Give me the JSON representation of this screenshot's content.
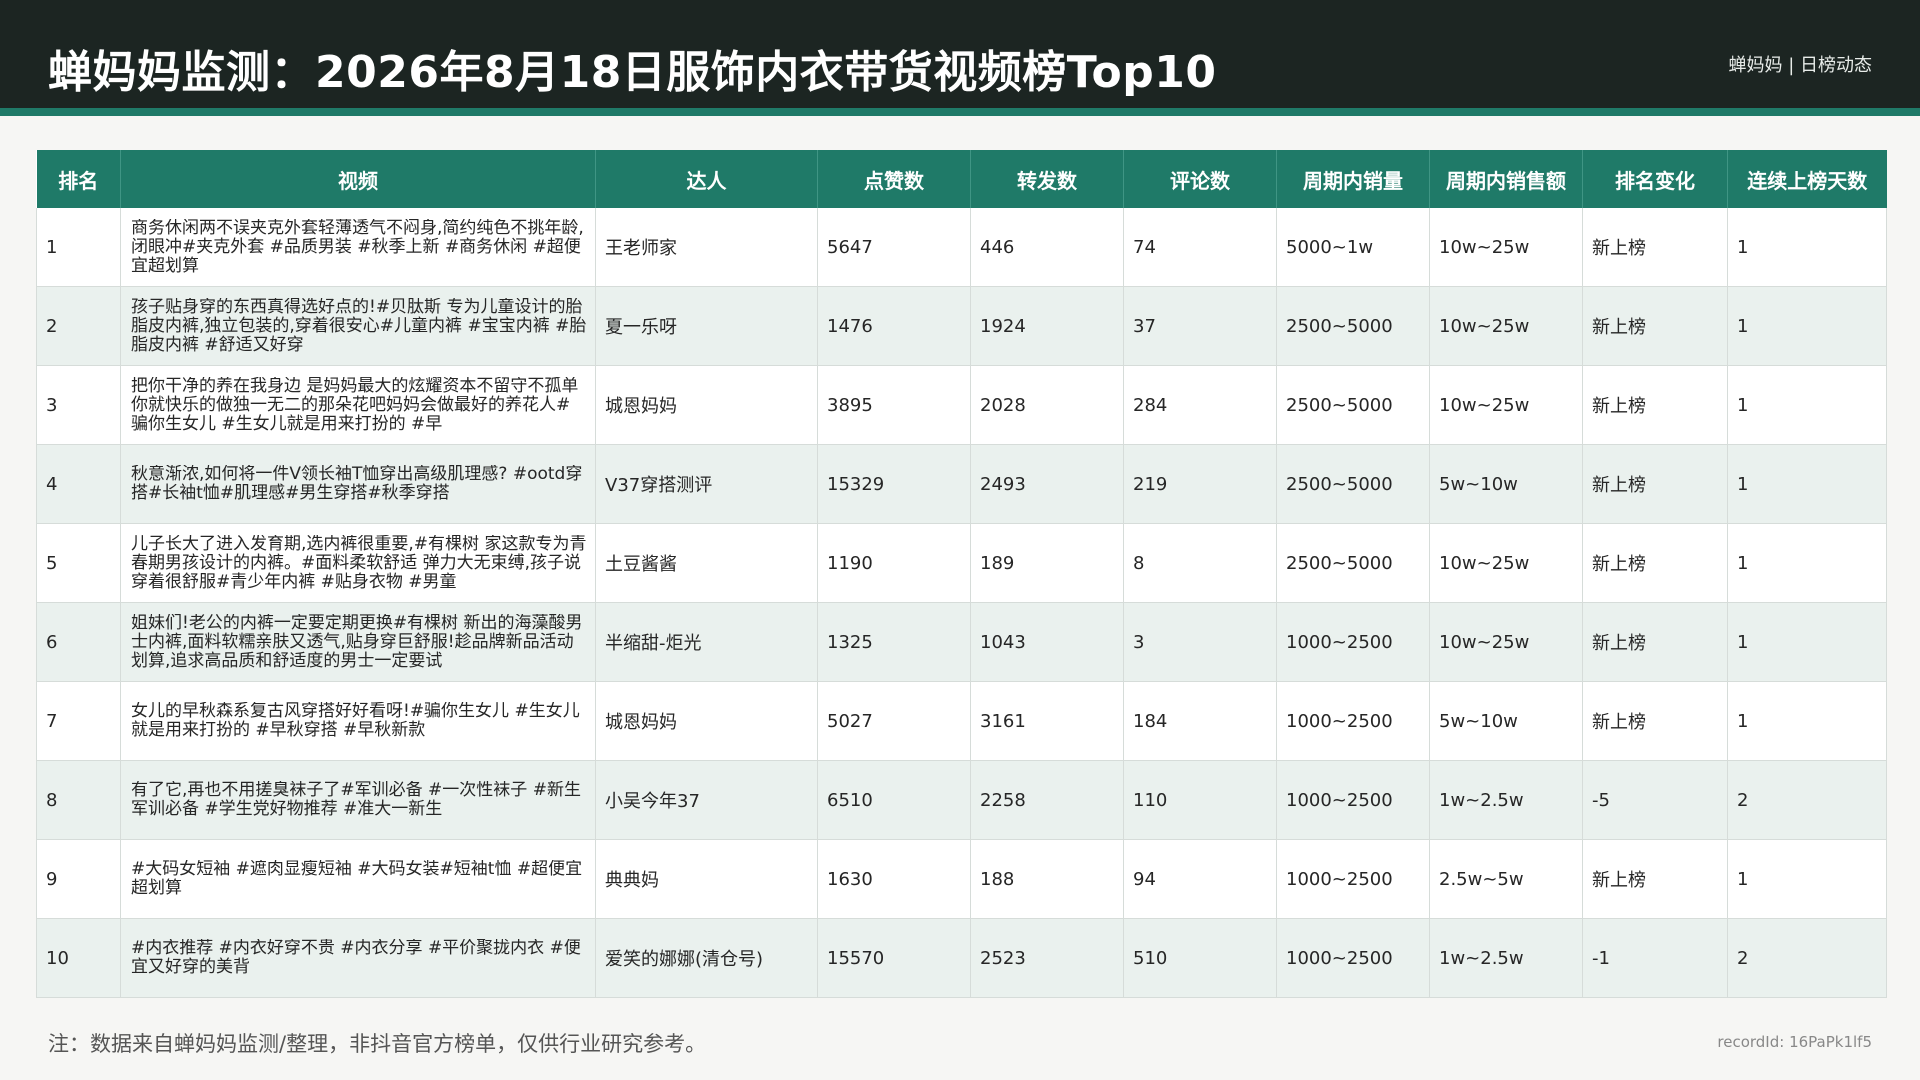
{
  "header": {
    "title": "蝉妈妈监测：2026年8月18日服饰内衣带货视频榜Top10",
    "right_label": "蝉妈妈 | 日榜动态"
  },
  "table": {
    "columns": [
      "排名",
      "视频",
      "达人",
      "点赞数",
      "转发数",
      "评论数",
      "周期内销量",
      "周期内销售额",
      "排名变化",
      "连续上榜天数"
    ],
    "rows": [
      [
        "1",
        "商务休闲两不误夹克外套轻薄透气不闷身,简约纯色不挑年龄,闭眼冲#夹克外套 #品质男装 #秋季上新 #商务休闲 #超便宜超划算",
        "王老师家",
        "5647",
        "446",
        "74",
        "5000~1w",
        "10w~25w",
        "新上榜",
        "1"
      ],
      [
        "2",
        "孩子贴身穿的东西真得选好点的!#贝肽斯 专为儿童设计的胎脂皮内裤,独立包装的,穿着很安心#儿童内裤 #宝宝内裤 #胎脂皮内裤 #舒适又好穿",
        "夏一乐呀",
        "1476",
        "1924",
        "37",
        "2500~5000",
        "10w~25w",
        "新上榜",
        "1"
      ],
      [
        "3",
        "把你干净的养在我身边 是妈妈最大的炫耀资本不留守不孤单 你就快乐的做独一无二的那朵花吧妈妈会做最好的养花人#骗你生女儿 #生女儿就是用来打扮的 #早",
        "城恩妈妈",
        "3895",
        "2028",
        "284",
        "2500~5000",
        "10w~25w",
        "新上榜",
        "1"
      ],
      [
        "4",
        "秋意渐浓,如何将一件V领长袖T恤穿出高级肌理感? #ootd穿搭#长袖t恤#肌理感#男生穿搭#秋季穿搭",
        "V37穿搭测评",
        "15329",
        "2493",
        "219",
        "2500~5000",
        "5w~10w",
        "新上榜",
        "1"
      ],
      [
        "5",
        "儿子长大了进入发育期,选内裤很重要,#有棵树 家这款专为青春期男孩设计的内裤。#面料柔软舒适 弹力大无束缚,孩子说穿着很舒服#青少年内裤 #贴身衣物 #男童",
        "土豆酱酱",
        "1190",
        "189",
        "8",
        "2500~5000",
        "10w~25w",
        "新上榜",
        "1"
      ],
      [
        "6",
        "姐妹们!老公的内裤一定要定期更换#有棵树 新出的海藻酸男士内裤,面料软糯亲肤又透气,贴身穿巨舒服!趁品牌新品活动划算,追求高品质和舒适度的男士一定要试",
        "半缩甜-炬光",
        "1325",
        "1043",
        "3",
        "1000~2500",
        "10w~25w",
        "新上榜",
        "1"
      ],
      [
        "7",
        "女儿的早秋森系复古风穿搭好好看呀!#骗你生女儿 #生女儿就是用来打扮的 #早秋穿搭 #早秋新款",
        "城恩妈妈",
        "5027",
        "3161",
        "184",
        "1000~2500",
        "5w~10w",
        "新上榜",
        "1"
      ],
      [
        "8",
        "有了它,再也不用搓臭袜子了#军训必备 #一次性袜子 #新生军训必备 #学生党好物推荐 #准大一新生",
        "小吴今年37",
        "6510",
        "2258",
        "110",
        "1000~2500",
        "1w~2.5w",
        "-5",
        "2"
      ],
      [
        "9",
        "#大码女短袖 #遮肉显瘦短袖 #大码女装#短袖t恤 #超便宜超划算",
        "典典妈",
        "1630",
        "188",
        "94",
        "1000~2500",
        "2.5w~5w",
        "新上榜",
        "1"
      ],
      [
        "10",
        "#内衣推荐 #内衣好穿不贵 #内衣分享 #平价聚拢内衣 #便宜又好穿的美背",
        "爱笑的娜娜(清仓号)",
        "15570",
        "2523",
        "510",
        "1000~2500",
        "1w~2.5w",
        "-1",
        "2"
      ]
    ]
  },
  "footer": {
    "note": "注：数据来自蝉妈妈监测/整理，非抖音官方榜单，仅供行业研究参考。",
    "record_id": "recordId: 16PaPk1lf5"
  },
  "colors": {
    "header_bg": "#1c2522",
    "accent": "#1f7a68",
    "row_alt": "#eaf1ee"
  }
}
